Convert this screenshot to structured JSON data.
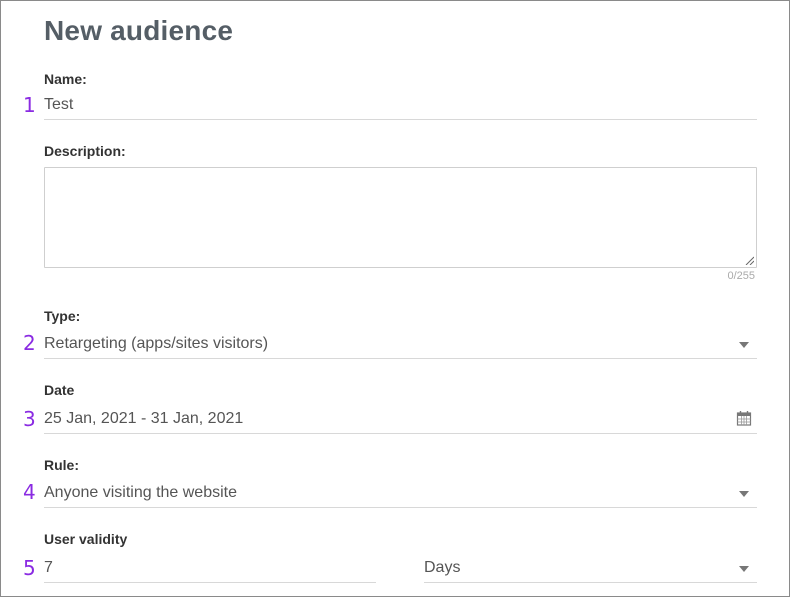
{
  "page": {
    "title": "New audience"
  },
  "markers": [
    "1",
    "2",
    "3",
    "4",
    "5"
  ],
  "fields": {
    "name": {
      "label": "Name:",
      "value": "Test"
    },
    "description": {
      "label": "Description:",
      "value": "",
      "counter": "0/255"
    },
    "type": {
      "label": "Type:",
      "value": "Retargeting (apps/sites visitors)"
    },
    "date": {
      "label": "Date",
      "value": "25 Jan, 2021 - 31 Jan, 2021"
    },
    "rule": {
      "label": "Rule:",
      "value": "Anyone visiting the website"
    },
    "user_validity": {
      "label": "User validity",
      "value": "7",
      "unit": "Days"
    }
  },
  "icons": {
    "dropdown": "chevron-down-icon",
    "calendar": "calendar-icon",
    "resize": "resize-handle-icon"
  },
  "colors": {
    "title": "#555e66",
    "marker": "#8a2be2",
    "underline": "#d8d8d8"
  }
}
